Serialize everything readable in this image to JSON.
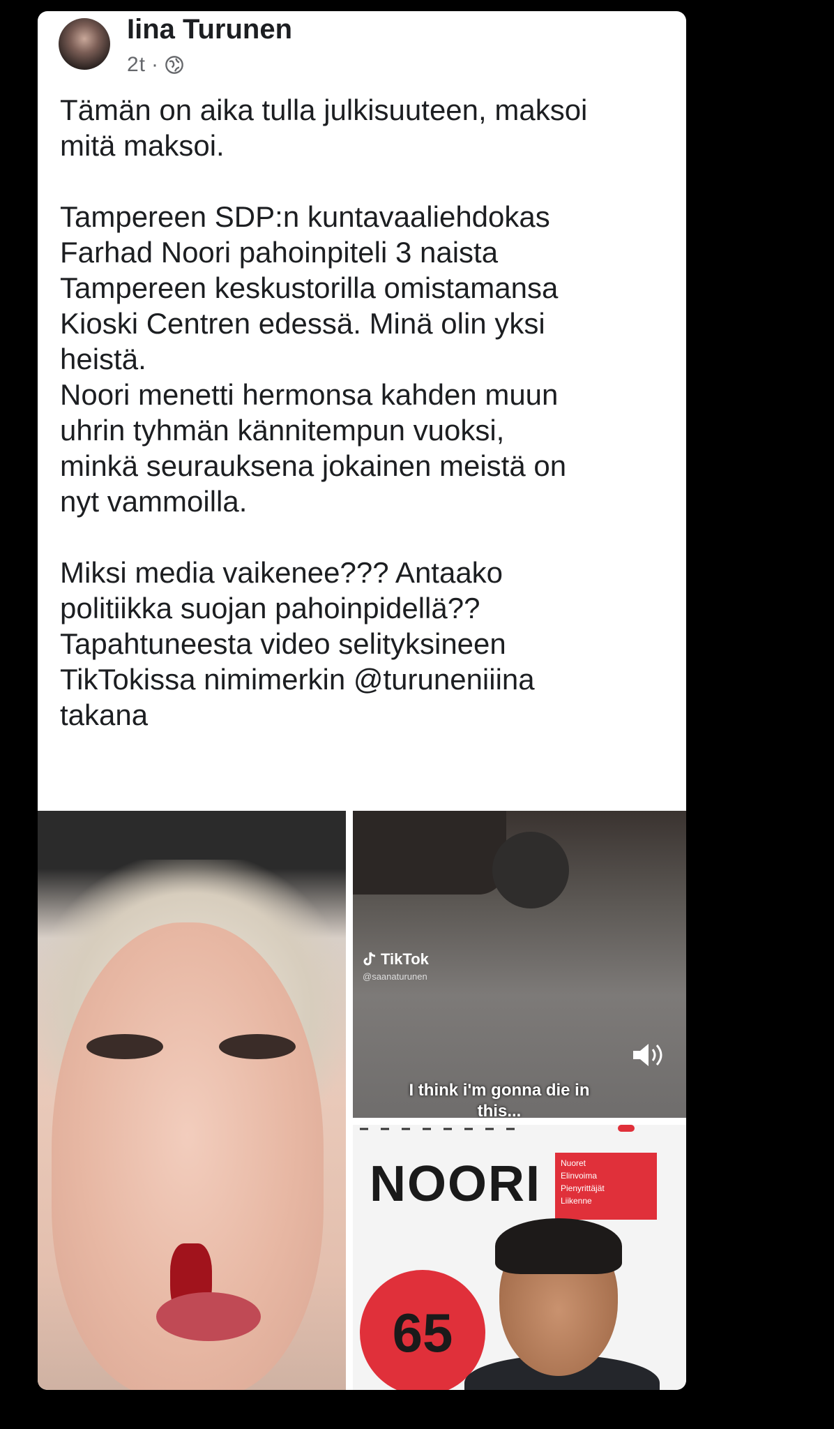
{
  "post": {
    "author": "Iina Turunen",
    "time": "2t",
    "separator": "·",
    "privacy_icon": "globe-icon",
    "text": "Tämän on aika tulla julkisuuteen, maksoi\nmitä maksoi.\n\nTampereen SDP:n kuntavaaliehdokas\nFarhad Noori pahoinpiteli 3 naista\nTampereen keskustorilla omistamansa\nKioski Centren edessä. Minä olin yksi\nheistä.\nNoori menetti hermonsa kahden muun\nuhrin tyhmän kännitempun vuoksi,\nminkä seurauksena jokainen meistä on\nnyt vammoilla.\n\nMiksi media vaikenee??? Antaako\npolitiikka suojan pahoinpidellä??\nTapahtuneesta video selityksineen\nTikTokissa nimimerkin @turuneniiina\ntakana"
  },
  "video": {
    "platform": "TikTok",
    "handle": "@saanaturunen",
    "caption": "I think i'm gonna die in this...",
    "sound_icon": "speaker-icon"
  },
  "poster": {
    "name": "NOORI",
    "tags": [
      "Nuoret",
      "Elinvoima",
      "Pienyrittäjät",
      "Liikenne"
    ],
    "number": "65"
  },
  "colors": {
    "accent_red": "#e0303a",
    "text_primary": "#1c1e21",
    "text_secondary": "#65676b"
  }
}
